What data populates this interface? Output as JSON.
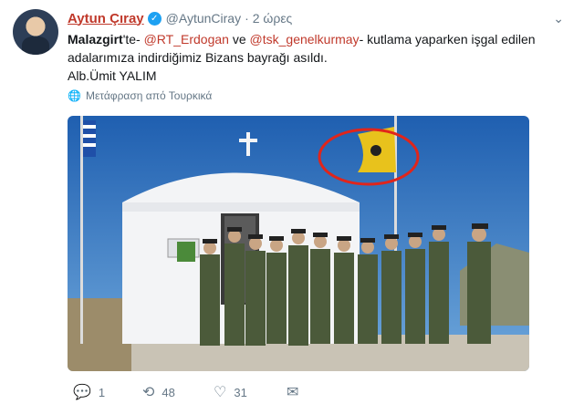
{
  "tweet": {
    "display_name": "Aytun Çıray",
    "handle": "@AytunCiray",
    "separator": "·",
    "time": "2 ώρες",
    "text_part1": "Malazgirt",
    "text_part2": "'te- ",
    "mention1": "@RT_Erdogan",
    "text_part3": " ve ",
    "mention2": "@tsk_genelkurmay",
    "text_part4": "- kutlama yaparken işgal edilen adalarımıza indirdiğimiz Bizans bayrağı  asıldı.",
    "signature": "Alb.Ümit YALIM",
    "translate": "Μετάφραση από Τουρκικά"
  },
  "actions": {
    "reply_count": "1",
    "retweet_count": "48",
    "like_count": "31"
  },
  "colors": {
    "accent": "#c0392b",
    "verified": "#1da1f2",
    "secondary_text": "#657786"
  }
}
